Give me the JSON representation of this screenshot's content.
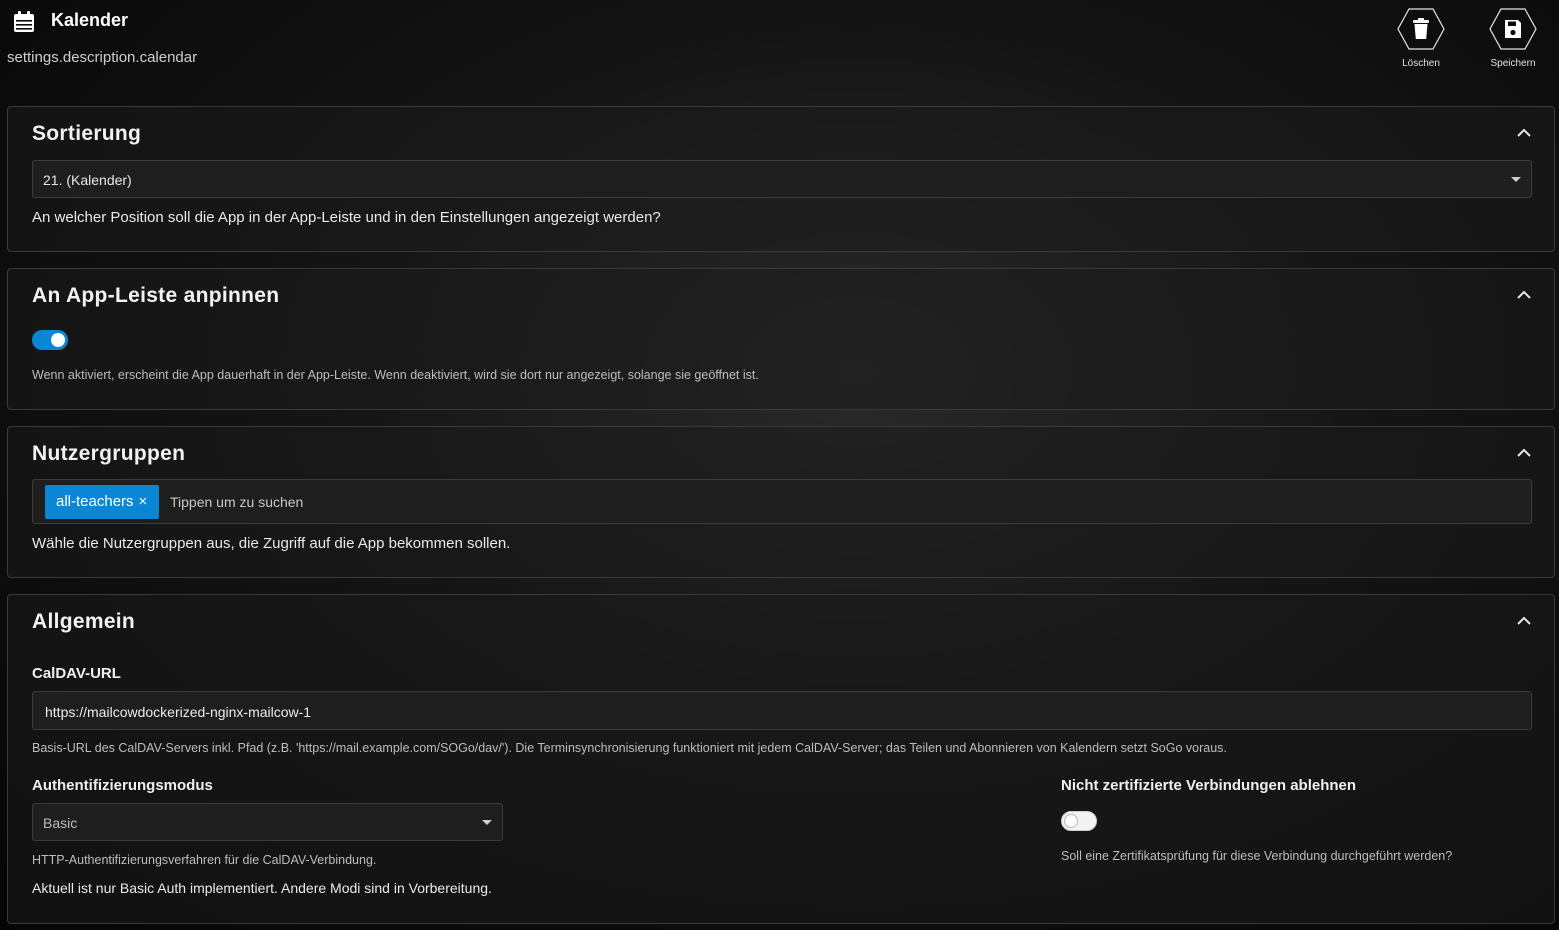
{
  "header": {
    "title": "Kalender",
    "description": "settings.description.calendar",
    "delete_label": "Löschen",
    "save_label": "Speichern"
  },
  "sort": {
    "title": "Sortierung",
    "selected": "21. (Kalender)",
    "help": "An welcher Position soll die App in der App-Leiste und in den Einstellungen angezeigt werden?"
  },
  "pin": {
    "title": "An App-Leiste anpinnen",
    "enabled": true,
    "help": "Wenn aktiviert, erscheint die App dauerhaft in der App-Leiste. Wenn deaktiviert, wird sie dort nur angezeigt, solange sie geöffnet ist."
  },
  "groups": {
    "title": "Nutzergruppen",
    "selected": [
      "all-teachers"
    ],
    "chip_remove": "×",
    "placeholder": "Tippen um zu suchen",
    "help": "Wähle die Nutzergruppen aus, die Zugriff auf die App bekommen sollen."
  },
  "general": {
    "title": "Allgemein",
    "caldav_label": "CalDAV-URL",
    "caldav_value": "https://mailcowdockerized-nginx-mailcow-1",
    "caldav_help": "Basis-URL des CalDAV-Servers inkl. Pfad (z.B. 'https://mail.example.com/SOGo/dav/'). Die Terminsynchronisierung funktioniert mit jedem CalDAV-Server; das Teilen und Abonnieren von Kalendern setzt SoGo voraus.",
    "auth_label": "Authentifizierungsmodus",
    "auth_value": "Basic",
    "auth_help": "HTTP-Authentifizierungsverfahren für die CalDAV-Verbindung.",
    "auth_note": "Aktuell ist nur Basic Auth implementiert. Andere Modi sind in Vorbereitung.",
    "reject_label": "Nicht zertifizierte Verbindungen ablehnen",
    "reject_enabled": false,
    "reject_help": "Soll eine Zertifikatsprüfung für diese Verbindung durchgeführt werden?"
  },
  "colors": {
    "accent": "#0a87d4",
    "background": "#0b0b0b",
    "card_border": "#3a3a3a"
  }
}
